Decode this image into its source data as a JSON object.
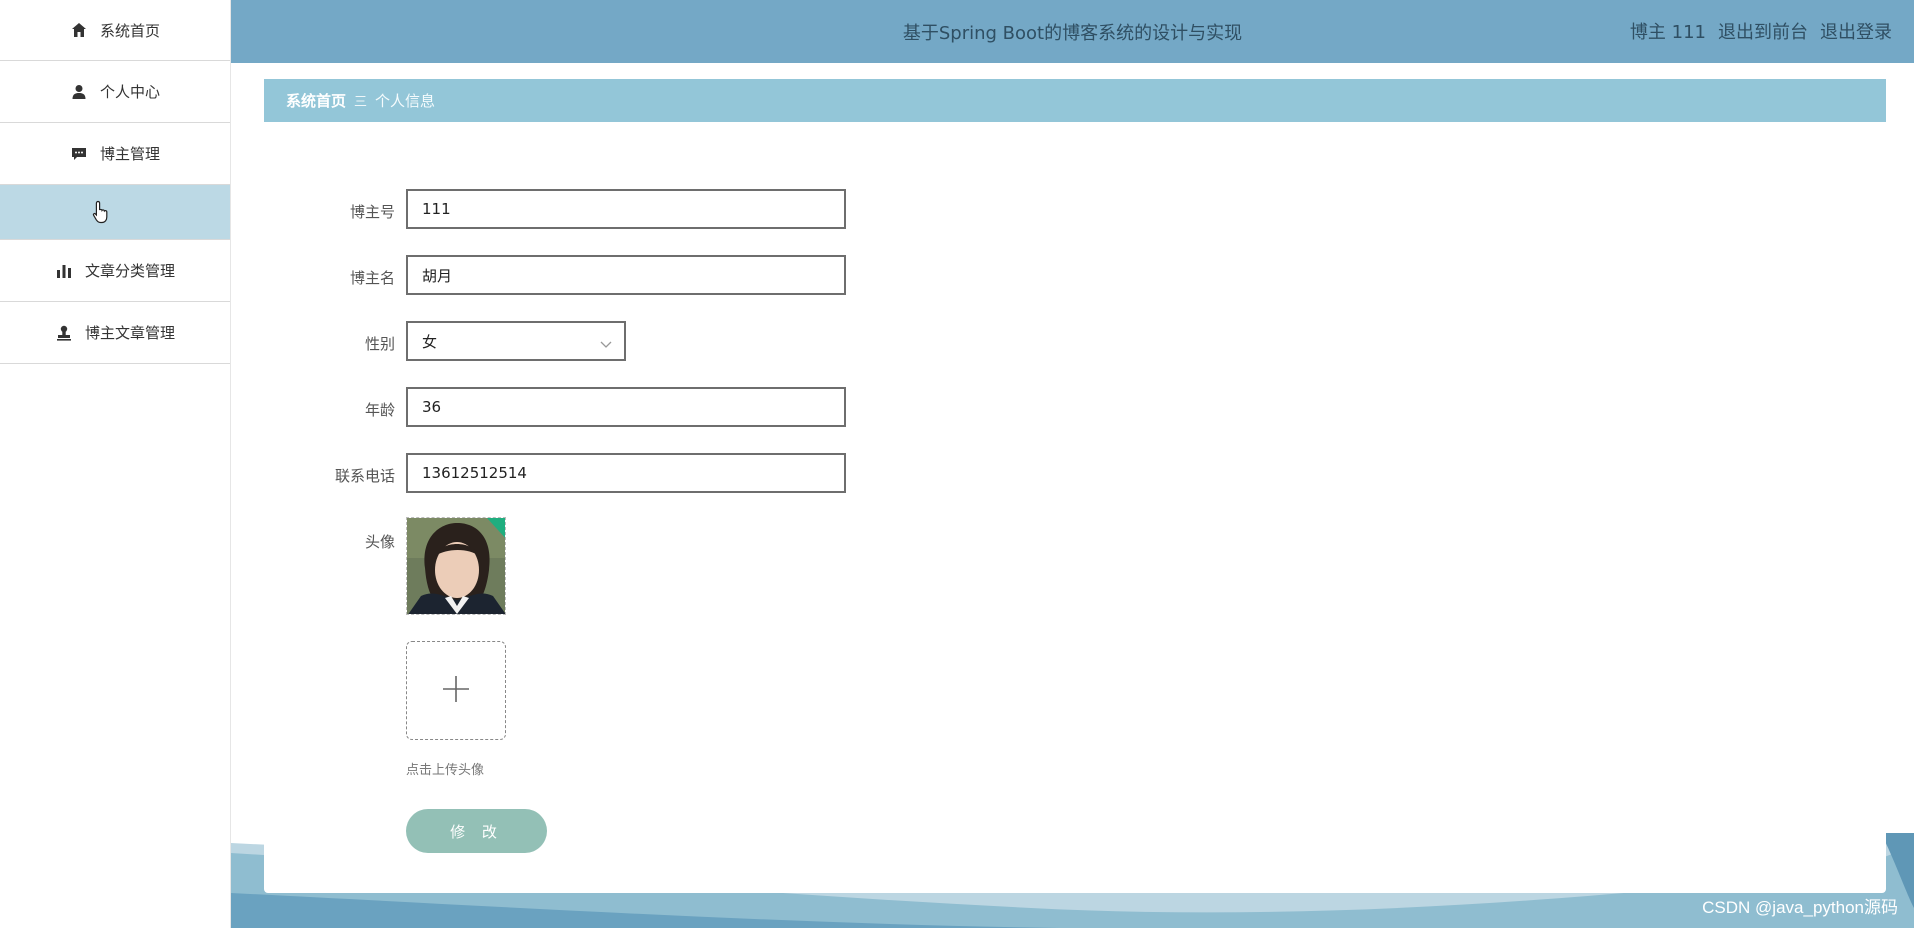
{
  "header": {
    "title": "基于Spring Boot的博客系统的设计与实现",
    "user_label": "博主 111",
    "front_link": "退出到前台",
    "logout_link": "退出登录",
    "background_color": "#74a8c6"
  },
  "sidebar": {
    "items": [
      {
        "label": "系统首页",
        "icon": "home-icon"
      },
      {
        "label": "个人中心",
        "icon": "user-icon"
      },
      {
        "label": "博主管理",
        "icon": "chat-icon"
      },
      {
        "label": "",
        "icon": "pointer-cursor-icon",
        "active": true
      },
      {
        "label": "文章分类管理",
        "icon": "bar-chart-icon"
      },
      {
        "label": "博主文章管理",
        "icon": "stamp-icon"
      }
    ],
    "active_color": "#bcd9e5"
  },
  "breadcrumb": {
    "home": "系统首页",
    "separator": "三",
    "current": "个人信息"
  },
  "form": {
    "blogger_id_label": "博主号",
    "blogger_id_value": "111",
    "blogger_name_label": "博主名",
    "blogger_name_value": "胡月",
    "gender_label": "性别",
    "gender_value": "女",
    "age_label": "年龄",
    "age_value": "36",
    "phone_label": "联系电话",
    "phone_value": "13612512514",
    "avatar_label": "头像",
    "upload_hint": "点击上传头像",
    "submit_label": "修 改"
  },
  "watermark": "CSDN @java_python源码"
}
